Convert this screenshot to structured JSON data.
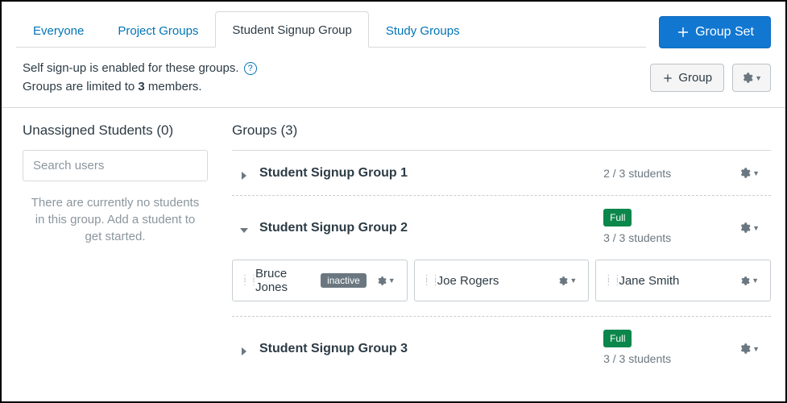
{
  "tabs": [
    {
      "label": "Everyone",
      "active": false
    },
    {
      "label": "Project Groups",
      "active": false
    },
    {
      "label": "Student Signup Group",
      "active": true
    },
    {
      "label": "Study Groups",
      "active": false
    }
  ],
  "buttons": {
    "group_set": "Group Set",
    "group": "Group"
  },
  "subheader": {
    "line1": "Self sign-up is enabled for these groups.",
    "line2_prefix": "Groups are limited to ",
    "limit": "3",
    "line2_suffix": " members."
  },
  "left": {
    "title": "Unassigned Students",
    "count": 0,
    "search_placeholder": "Search users",
    "empty_msg": "There are currently no students in this group. Add a student to get started."
  },
  "right": {
    "title": "Groups",
    "count": 3
  },
  "groups": [
    {
      "name": "Student Signup Group 1",
      "expanded": false,
      "count_text": "2 / 3 students",
      "badge": null,
      "members": []
    },
    {
      "name": "Student Signup Group 2",
      "expanded": true,
      "count_text": "3 / 3 students",
      "badge": "Full",
      "members": [
        {
          "name": "Bruce Jones",
          "status": "inactive"
        },
        {
          "name": "Joe Rogers",
          "status": null
        },
        {
          "name": "Jane Smith",
          "status": null
        }
      ]
    },
    {
      "name": "Student Signup Group 3",
      "expanded": false,
      "count_text": "3 / 3 students",
      "badge": "Full",
      "members": []
    }
  ]
}
